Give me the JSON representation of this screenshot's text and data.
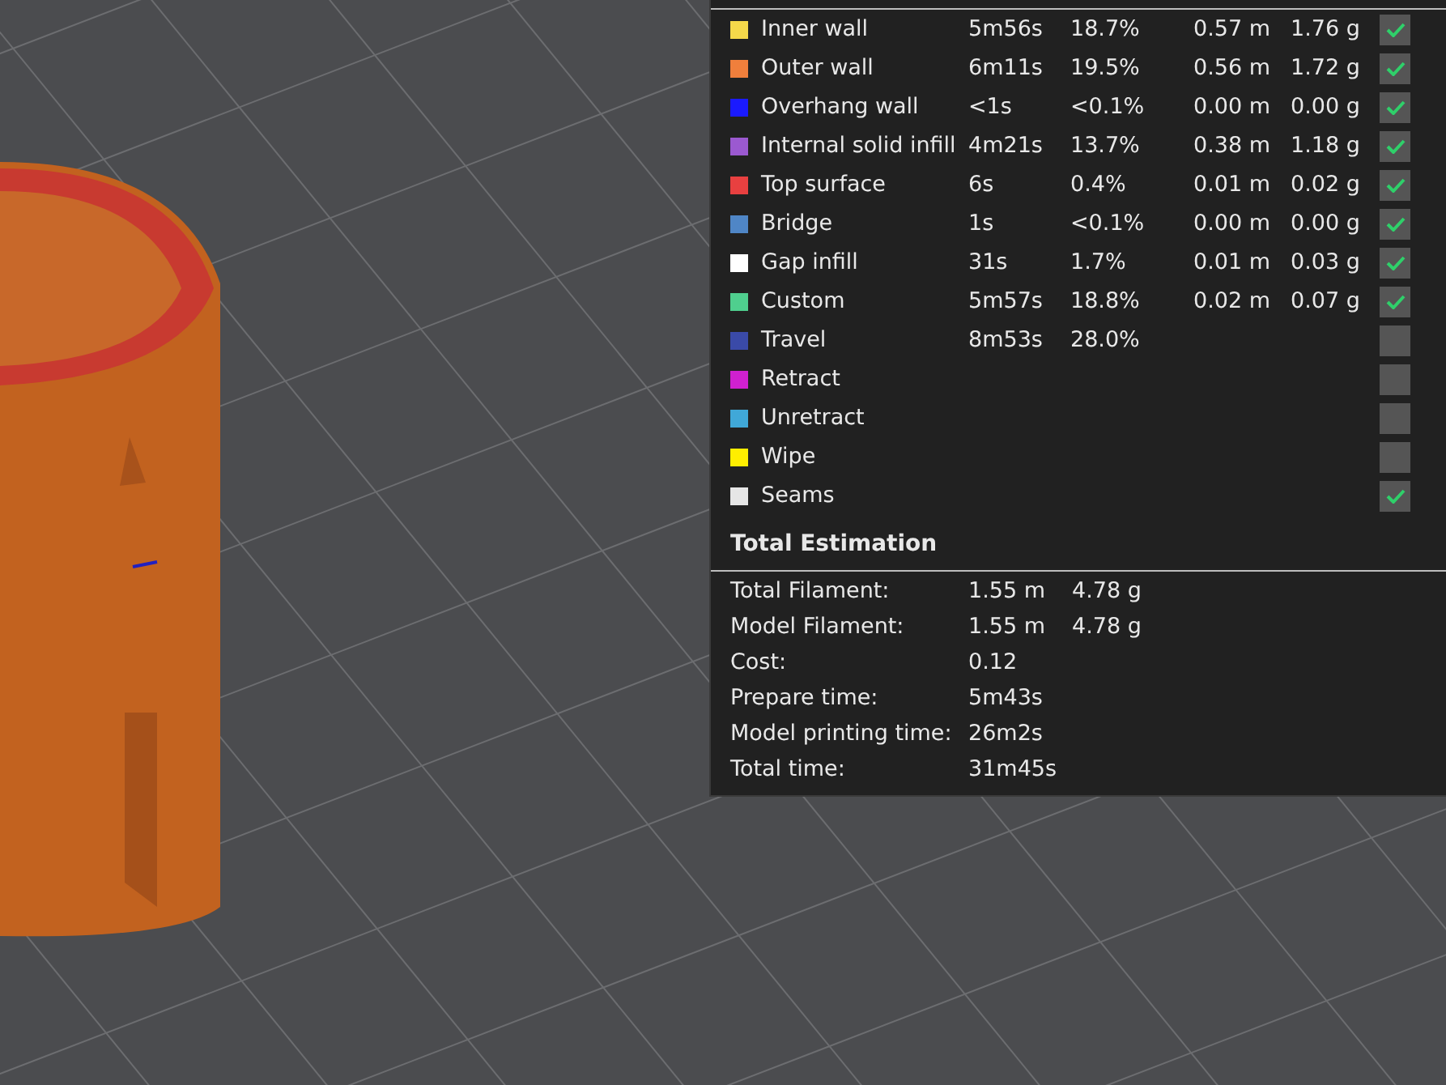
{
  "legend": {
    "rows": [
      {
        "label": "Inner wall",
        "color": "#f5d94a",
        "time": "5m56s",
        "percent": "18.7%",
        "length": "0.57 m",
        "weight": "1.76 g",
        "checked": true
      },
      {
        "label": "Outer wall",
        "color": "#f07f3c",
        "time": "6m11s",
        "percent": "19.5%",
        "length": "0.56 m",
        "weight": "1.72 g",
        "checked": true
      },
      {
        "label": "Overhang wall",
        "color": "#1a1aff",
        "time": "<1s",
        "percent": "<0.1%",
        "length": "0.00 m",
        "weight": "0.00 g",
        "checked": true
      },
      {
        "label": "Internal solid infill",
        "color": "#9b59d0",
        "time": "4m21s",
        "percent": "13.7%",
        "length": "0.38 m",
        "weight": "1.18 g",
        "checked": true
      },
      {
        "label": "Top surface",
        "color": "#e84040",
        "time": "6s",
        "percent": "0.4%",
        "length": "0.01 m",
        "weight": "0.02 g",
        "checked": true
      },
      {
        "label": "Bridge",
        "color": "#4f86c6",
        "time": "1s",
        "percent": "<0.1%",
        "length": "0.00 m",
        "weight": "0.00 g",
        "checked": true
      },
      {
        "label": "Gap infill",
        "color": "#ffffff",
        "time": "31s",
        "percent": "1.7%",
        "length": "0.01 m",
        "weight": "0.03 g",
        "checked": true
      },
      {
        "label": "Custom",
        "color": "#4fcf8e",
        "time": "5m57s",
        "percent": "18.8%",
        "length": "0.02 m",
        "weight": "0.07 g",
        "checked": true
      },
      {
        "label": "Travel",
        "color": "#3a4aa8",
        "time": "8m53s",
        "percent": "28.0%",
        "checked": false
      },
      {
        "label": "Retract",
        "color": "#d020d0",
        "checked": false
      },
      {
        "label": "Unretract",
        "color": "#40a8d8",
        "checked": false
      },
      {
        "label": "Wipe",
        "color": "#ffee00",
        "checked": false
      },
      {
        "label": "Seams",
        "color": "#e6e6e6",
        "checked": true
      }
    ]
  },
  "total_estimation": {
    "title": "Total Estimation",
    "rows": [
      {
        "label": "Total Filament:",
        "value": "1.55 m",
        "value_2": "4.78 g"
      },
      {
        "label": "Model Filament:",
        "value": "1.55 m",
        "value_2": "4.78 g"
      },
      {
        "label": "Cost:",
        "value": "0.12"
      },
      {
        "label": "Prepare time:",
        "value": "5m43s"
      },
      {
        "label": "Model printing time:",
        "value": "26m2s"
      },
      {
        "label": "Total time:",
        "value": "31m45s"
      }
    ]
  }
}
